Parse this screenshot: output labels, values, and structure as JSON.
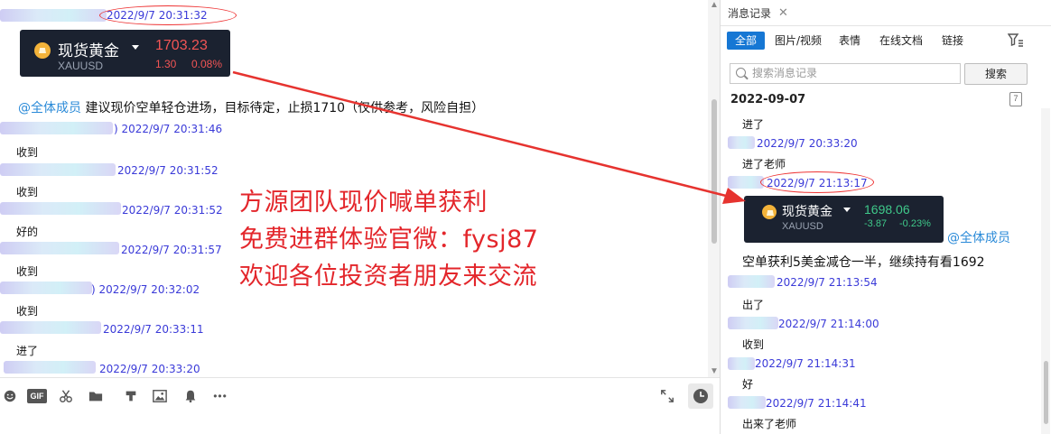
{
  "chat": {
    "rows": [
      {
        "ts": "2022/9/7 20:31:32",
        "text": ""
      },
      {
        "ts": "2022/9/7 20:31:46",
        "text": "收到"
      },
      {
        "ts": "2022/9/7 20:31:52",
        "text": "收到"
      },
      {
        "ts": "2022/9/7 20:31:52",
        "text": "好的"
      },
      {
        "ts": "2022/9/7 20:31:57",
        "text": "收到"
      },
      {
        "ts": "2022/9/7 20:32:02",
        "text": "收到"
      },
      {
        "ts": "2022/9/7 20:33:11",
        "text": "进了"
      },
      {
        "ts": "2022/9/7 20:33:20",
        "text": ""
      }
    ],
    "gold_card": {
      "name": "现货黄金",
      "symbol": "XAUUSD",
      "price": "1703.23",
      "change": "1.30",
      "change_pct": "0.08%"
    },
    "mention": "@全体成员",
    "advice": "建议现价空单轻仓进场，目标待定，止损1710（仅供参考，风险自担）",
    "partial_ts_prefix": ")"
  },
  "promo": {
    "line1": "方源团队现价喊单获利",
    "line2": "免费进群体验官微：fysj87",
    "line3": "欢迎各位投资者朋友来交流"
  },
  "toolbar": {
    "icons": [
      "emoji-icon",
      "gif-icon",
      "scissors-icon",
      "folder-icon",
      "music-icon",
      "image-icon",
      "bell-icon",
      "more-icon"
    ],
    "gif_label": "GIF",
    "more_label": "•••"
  },
  "panel": {
    "tab_title": "消息记录",
    "close": "✕",
    "filters": [
      "全部",
      "图片/视频",
      "表情",
      "在线文档",
      "链接"
    ],
    "search_placeholder": "搜索消息记录",
    "search_button": "搜索",
    "date": "2022-09-07",
    "calendar_day": "7",
    "entries": [
      {
        "ts": "",
        "text": "进了"
      },
      {
        "ts": "2022/9/7 20:33:20",
        "text": "进了老师"
      },
      {
        "ts": "2022/9/7 21:13:17",
        "text": ""
      },
      {
        "ts": "2022/9/7 21:13:54",
        "text": "出了"
      },
      {
        "ts": "2022/9/7 21:14:00",
        "text": "收到"
      },
      {
        "ts": "2022/9/7 21:14:31",
        "text": "好"
      },
      {
        "ts": "2022/9/7 21:14:41",
        "text": "出来了老师"
      }
    ],
    "gold_card": {
      "name": "现货黄金",
      "symbol": "XAUUSD",
      "price": "1698.06",
      "change": "-3.87",
      "change_pct": "-0.23%"
    },
    "mention": "@全体成员",
    "profit_msg": "空单获利5美金减仓一半，继续持有看1692"
  },
  "colors": {
    "accent": "#1677d4",
    "timestamp": "#3a3ad8",
    "promo_red": "#e3262b",
    "up_red": "#f25555",
    "down_green": "#3fc98a",
    "card_bg": "#1b2230"
  }
}
